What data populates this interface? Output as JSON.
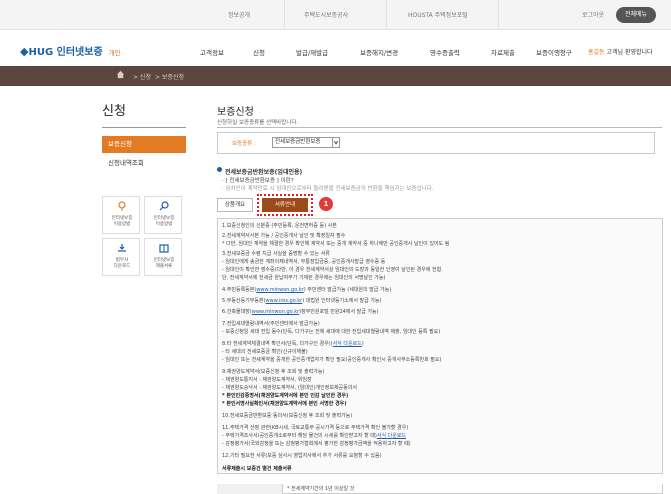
{
  "topbar": {
    "links": [
      "정보공개",
      "주택도시보증공사",
      "HOUSTA 주택정보포털"
    ],
    "logout": "로그아웃",
    "login": "전체메뉴"
  },
  "header": {
    "logo": "HUG 인터넷보증",
    "logo_sub": "개인",
    "nav": [
      "고객정보",
      "신청",
      "발급/재발급",
      "보증해지/변경",
      "영수증출력",
      "자료제출",
      "보증이행청구"
    ],
    "user_name": "홍길동",
    "user_suffix": "고객님 환영합니다"
  },
  "breadcrumb": [
    "> 신청",
    "> 보증신청"
  ],
  "left": {
    "title": "신청",
    "menu_active": "보증신청",
    "menu_item": "신청내역조회",
    "quick": [
      {
        "l1": "인터넷보증",
        "l2": "이용방법",
        "icon": "location-icon"
      },
      {
        "l1": "인터넷보증",
        "l2": "이용방법",
        "icon": "search-icon"
      },
      {
        "l1": "법무사",
        "l2": "다운로드",
        "icon": "download-icon"
      },
      {
        "l1": "인터넷보증",
        "l2": "제출서류",
        "icon": "book-icon"
      }
    ]
  },
  "main": {
    "title": "보증신청",
    "desc": "신청하실 보증종류를 선택바랍니다.",
    "select_label": "보증종류 :",
    "select_value": "전세보증금반환보증",
    "section_title": "전세보증금반환보증(임대인용)",
    "section_lines": [
      "· [ 전세보증금반환보증 ] 이란?",
      "· 임차인이 계약만료 시 임대인으로부터 돌려받을 전세보증금의 반환을 책임지는 보증입니다."
    ],
    "tab_default": "상품개요",
    "tab_active": "서류안내",
    "badge": "1",
    "items": [
      "1.보증신청인의 신분증 (주민등록, 운전면허증 등) 사본",
      "2.전세계약서사본 가능 / 공인중개사 날인 및 확정일자 필수",
      "  * 다만, 임대인 계약을 체결한 경우 확인해 계약서 또는 중개 계약서 중 하나에만 공인중개사 날인이 있어도 됨",
      "3.전세보증금 수령 지급 사실을 증명할 수 있는 서류",
      "  - 임대인에게 송금한 계좌이체내역서, 무통장입금증, 공인중개사발급 영수증 등",
      "  - 임대인이 확인한 영수증(다만, 이 경우 전세계약서상 임대인의 도장과 동일한 인영이 날인된 경우에 한함.",
      "    단, 전세계약서에 전세금 완납여부가 기재된 경우에는 임대인의 서명날인 가능)",
      "4.주민등록등본(",
      "5.부동산등기부등본(",
      "6.건축물대장(",
      "7.전입세대열람내역서(주민센터에서 발급가능)",
      "  - 보증신청일 세대 전입 동수(단독, 다가구는 전체 세대에 대한 전입세대열람내역 제출, 임대인 등록 필요)",
      "8.타 전세계약체결내역 확인서(단독, 다가구인 경우)(",
      "  - 타 세대의 전세보증금 확인(신규이체불)",
      "  - 임대인 또는 전세계약을 중개한 공인중개업자가 확인 필요(공인중개사 확인시 중개사무소등록번호 필요)",
      "9.채권양도계약서(보증신청 후 조회 및 출력가능)",
      "  - 채권양도통지서 : 채권양도계약서, 위임장",
      "  - 채권양도승낙서 : 채권양도계약서, (임대인)개인정보제공동의서",
      "10.전세보증금반환보증 동의서(보증신청 후 조회 및 출력가능)",
      "11.주택가격 산정 관련(KB시세, 국토교통부 공시가격 등으로 주택가격 확인 불가할 경우)",
      "  - 주택가격조사서(공인중개소로부터 해당 물건의 시세를 확인받고자 할 때)",
      "  - 감정평가서(국외감정을 또는 감정평가협회에서 평가한 감정평가금액을 적용하고자 할 때)",
      "12.기타 필요한 서류(보증 심사시 영업지사에서 추가 서류를 요청할 수 있음)",
      "서류제출시 보증건 별건 제출서류"
    ],
    "links": {
      "minwon": "www.minwon.go.kr",
      "iros": "www.iros.go.kr",
      "eais": "www.minwon.go.kr",
      "form": "서식 다운로드",
      "form2": "서식 다운로드"
    },
    "link_suffix": {
      "s4": ") 주민센터 발급가능 (세대원의 발급 가능)",
      "s5": ") 대법원 인터넷등기소에서 발급 가능)",
      "s6": ")정부민원포털 민원24에서 발급 가능)",
      "s8": ")"
    },
    "bold_items": [
      "* 본인인감증명서(채권양도계약서에 본인 인감 날인한 경우)",
      "* 본인서명사실확인서(채권양도계약서에 본인 서명한 경우)"
    ],
    "bottom": "* 전세계약기간의 1년 이상일 것"
  }
}
